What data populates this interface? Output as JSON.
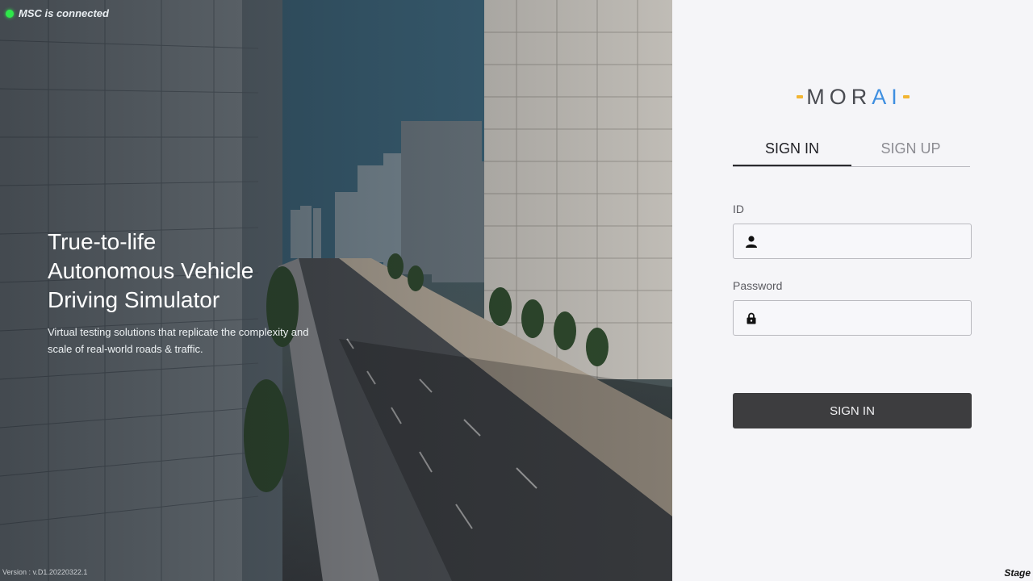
{
  "status": {
    "text": "MSC is connected",
    "color": "#2ee84a"
  },
  "hero": {
    "headline": [
      "True-to-life",
      "Autonomous Vehicle",
      "Driving Simulator"
    ],
    "subtext": "Virtual testing solutions that replicate the complexity and scale of real-world roads & traffic.",
    "version": "Version : v.D1.20220322.1"
  },
  "brand": {
    "prefix": "MOR",
    "accent": "AI",
    "bar_color": "#f2b533",
    "accent_color": "#3f8fe0"
  },
  "tabs": [
    {
      "label": "SIGN IN",
      "active": true
    },
    {
      "label": "SIGN UP",
      "active": false
    }
  ],
  "form": {
    "id_label": "ID",
    "id_value": "",
    "id_icon": "user-icon",
    "password_label": "Password",
    "password_value": "",
    "password_icon": "lock-icon",
    "submit_label": "SIGN IN"
  },
  "environment": "Stage"
}
